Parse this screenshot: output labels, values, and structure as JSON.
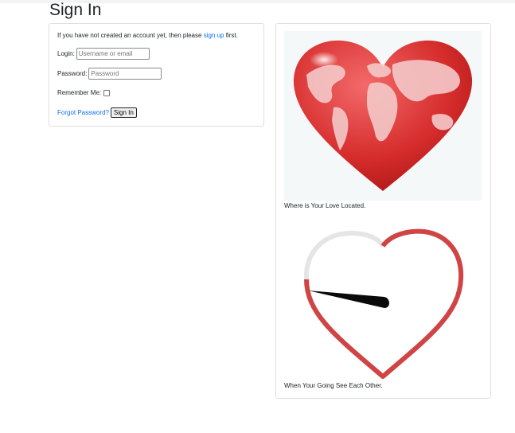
{
  "page": {
    "title": "Sign In"
  },
  "signin": {
    "intro_before": "If you have not created an account yet, then please ",
    "signup_link": "sign up",
    "intro_after": " first.",
    "login_label": "Login:",
    "login_placeholder": "Username or email",
    "password_label": "Password:",
    "password_placeholder": "Password",
    "remember_label": "Remember Me:",
    "remember_checked": false,
    "forgot_link": "Forgot Password?",
    "submit_label": "Sign In"
  },
  "gallery": {
    "items": [
      {
        "image_icon": "globe-heart-icon",
        "caption": "Where is Your Love Located."
      },
      {
        "image_icon": "heart-gauge-icon",
        "caption": "When Your Going See Each Other."
      }
    ]
  },
  "colors": {
    "link": "#0d6efd",
    "heart_red": "#d43b3b",
    "gauge_red": "#cf4444",
    "gauge_gray": "#e5e5e5"
  }
}
